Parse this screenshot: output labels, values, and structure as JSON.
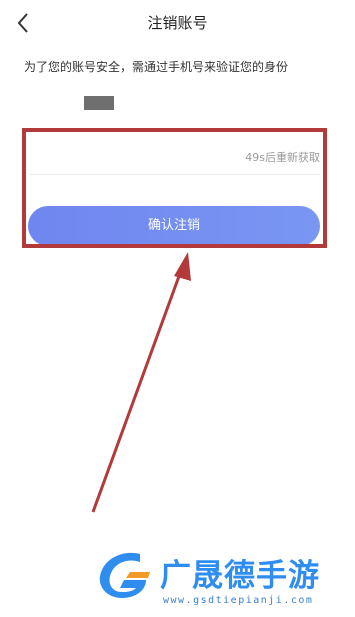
{
  "header": {
    "title": "注销账号",
    "back_icon": "chevron-left-icon"
  },
  "subtitle": "为了您的账号安全，需通过手机号来验证您的身份",
  "verification": {
    "code_placeholder": "",
    "resend_text": "49s后重新获取"
  },
  "confirm_button": {
    "label": "确认注销"
  },
  "annotation": {
    "color": "#b23a3a"
  },
  "watermark": {
    "brand": "广晟德手游",
    "url": "www.gsdtiepianji.com"
  }
}
